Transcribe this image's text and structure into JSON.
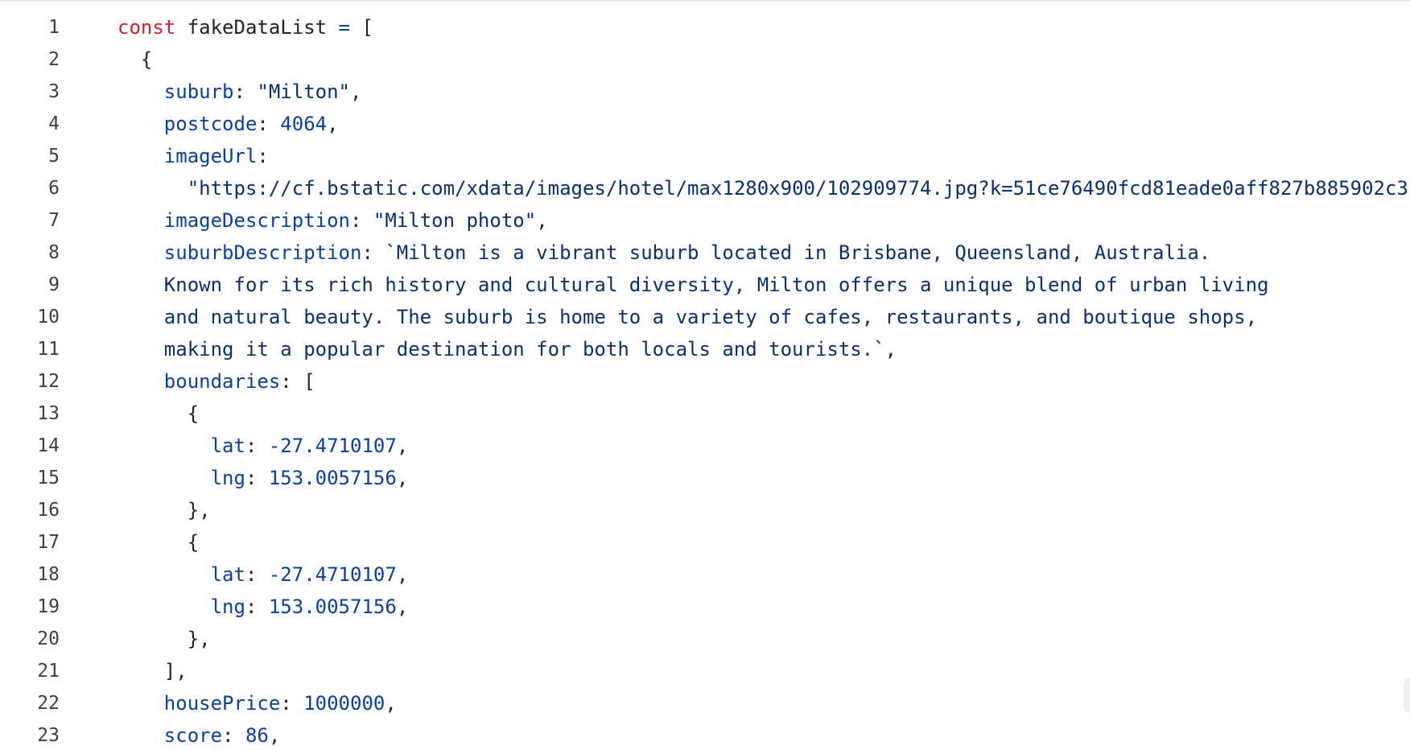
{
  "colors": {
    "keyword": "#cf222e",
    "property": "#0a3f9c",
    "number": "#0a3f9c",
    "string": "#0a2f6b",
    "text": "#1f2328",
    "line_number": "#3b3f45",
    "background": "#ffffff"
  },
  "code": {
    "lines": [
      {
        "number": "1",
        "tokens": [
          {
            "type": "keyword",
            "text": "const"
          },
          {
            "type": "plain",
            "text": " fakeDataList "
          },
          {
            "type": "operator",
            "text": "="
          },
          {
            "type": "punct",
            "text": " ["
          }
        ]
      },
      {
        "number": "2",
        "tokens": [
          {
            "type": "punct",
            "text": "  {"
          }
        ]
      },
      {
        "number": "3",
        "tokens": [
          {
            "type": "plain",
            "text": "    "
          },
          {
            "type": "property",
            "text": "suburb"
          },
          {
            "type": "punct",
            "text": ": "
          },
          {
            "type": "string",
            "text": "\"Milton\""
          },
          {
            "type": "punct",
            "text": ","
          }
        ]
      },
      {
        "number": "4",
        "tokens": [
          {
            "type": "plain",
            "text": "    "
          },
          {
            "type": "property",
            "text": "postcode"
          },
          {
            "type": "punct",
            "text": ": "
          },
          {
            "type": "number",
            "text": "4064"
          },
          {
            "type": "punct",
            "text": ","
          }
        ]
      },
      {
        "number": "5",
        "tokens": [
          {
            "type": "plain",
            "text": "    "
          },
          {
            "type": "property",
            "text": "imageUrl"
          },
          {
            "type": "punct",
            "text": ":"
          }
        ]
      },
      {
        "number": "6",
        "tokens": [
          {
            "type": "plain",
            "text": "      "
          },
          {
            "type": "string",
            "text": "\"https://cf.bstatic.com/xdata/images/hotel/max1280x900/102909774.jpg?k=51ce76490fcd81eade0aff827b885902c3"
          }
        ]
      },
      {
        "number": "7",
        "tokens": [
          {
            "type": "plain",
            "text": "    "
          },
          {
            "type": "property",
            "text": "imageDescription"
          },
          {
            "type": "punct",
            "text": ": "
          },
          {
            "type": "string",
            "text": "\"Milton photo\""
          },
          {
            "type": "punct",
            "text": ","
          }
        ]
      },
      {
        "number": "8",
        "tokens": [
          {
            "type": "plain",
            "text": "    "
          },
          {
            "type": "property",
            "text": "suburbDescription"
          },
          {
            "type": "punct",
            "text": ": "
          },
          {
            "type": "string",
            "text": "`Milton is a vibrant suburb located in Brisbane, Queensland, Australia."
          }
        ]
      },
      {
        "number": "9",
        "tokens": [
          {
            "type": "string",
            "text": "    Known for its rich history and cultural diversity, Milton offers a unique blend of urban living"
          }
        ]
      },
      {
        "number": "10",
        "tokens": [
          {
            "type": "string",
            "text": "    and natural beauty. The suburb is home to a variety of cafes, restaurants, and boutique shops,"
          }
        ]
      },
      {
        "number": "11",
        "tokens": [
          {
            "type": "string",
            "text": "    making it a popular destination for both locals and tourists.`"
          },
          {
            "type": "punct",
            "text": ","
          }
        ]
      },
      {
        "number": "12",
        "tokens": [
          {
            "type": "plain",
            "text": "    "
          },
          {
            "type": "property",
            "text": "boundaries"
          },
          {
            "type": "punct",
            "text": ": ["
          }
        ]
      },
      {
        "number": "13",
        "tokens": [
          {
            "type": "punct",
            "text": "      {"
          }
        ]
      },
      {
        "number": "14",
        "tokens": [
          {
            "type": "plain",
            "text": "        "
          },
          {
            "type": "property",
            "text": "lat"
          },
          {
            "type": "punct",
            "text": ": "
          },
          {
            "type": "number",
            "text": "-27.4710107"
          },
          {
            "type": "punct",
            "text": ","
          }
        ]
      },
      {
        "number": "15",
        "tokens": [
          {
            "type": "plain",
            "text": "        "
          },
          {
            "type": "property",
            "text": "lng"
          },
          {
            "type": "punct",
            "text": ": "
          },
          {
            "type": "number",
            "text": "153.0057156"
          },
          {
            "type": "punct",
            "text": ","
          }
        ]
      },
      {
        "number": "16",
        "tokens": [
          {
            "type": "punct",
            "text": "      },"
          }
        ]
      },
      {
        "number": "17",
        "tokens": [
          {
            "type": "punct",
            "text": "      {"
          }
        ]
      },
      {
        "number": "18",
        "tokens": [
          {
            "type": "plain",
            "text": "        "
          },
          {
            "type": "property",
            "text": "lat"
          },
          {
            "type": "punct",
            "text": ": "
          },
          {
            "type": "number",
            "text": "-27.4710107"
          },
          {
            "type": "punct",
            "text": ","
          }
        ]
      },
      {
        "number": "19",
        "tokens": [
          {
            "type": "plain",
            "text": "        "
          },
          {
            "type": "property",
            "text": "lng"
          },
          {
            "type": "punct",
            "text": ": "
          },
          {
            "type": "number",
            "text": "153.0057156"
          },
          {
            "type": "punct",
            "text": ","
          }
        ]
      },
      {
        "number": "20",
        "tokens": [
          {
            "type": "punct",
            "text": "      },"
          }
        ]
      },
      {
        "number": "21",
        "tokens": [
          {
            "type": "punct",
            "text": "    ],"
          }
        ]
      },
      {
        "number": "22",
        "tokens": [
          {
            "type": "plain",
            "text": "    "
          },
          {
            "type": "property",
            "text": "housePrice"
          },
          {
            "type": "punct",
            "text": ": "
          },
          {
            "type": "number",
            "text": "1000000"
          },
          {
            "type": "punct",
            "text": ","
          }
        ]
      },
      {
        "number": "23",
        "tokens": [
          {
            "type": "plain",
            "text": "    "
          },
          {
            "type": "property",
            "text": "score"
          },
          {
            "type": "punct",
            "text": ": "
          },
          {
            "type": "number",
            "text": "86"
          },
          {
            "type": "punct",
            "text": ","
          }
        ]
      }
    ]
  }
}
